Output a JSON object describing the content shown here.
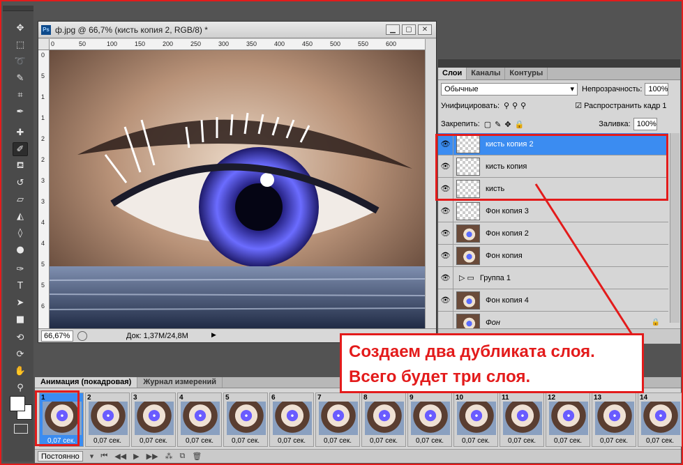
{
  "document": {
    "title": "ф.jpg @ 66,7% (кисть копия 2, RGB/8) *",
    "zoom": "66,67%",
    "doc_info": "Док: 1,37M/24,8M",
    "ruler_h": [
      "0",
      "50",
      "100",
      "150",
      "200",
      "250",
      "300",
      "350",
      "400",
      "450",
      "500",
      "550",
      "600"
    ],
    "ruler_v": [
      "0",
      "5",
      "1",
      "1",
      "2",
      "2",
      "3",
      "3",
      "4",
      "4",
      "5",
      "5",
      "6"
    ]
  },
  "layers_panel": {
    "tabs": [
      "Слои",
      "Каналы",
      "Контуры"
    ],
    "blend_mode": "Обычные",
    "opacity_label": "Непрозрачность:",
    "opacity_value": "100%",
    "unify_label": "Унифицировать:",
    "propagate_label": "Распространить кадр 1",
    "lock_label": "Закрепить:",
    "fill_label": "Заливка:",
    "fill_value": "100%",
    "layers": [
      {
        "name": "кисть копия 2",
        "selected": true,
        "thumb": "transparent"
      },
      {
        "name": "кисть копия",
        "selected": false,
        "thumb": "transparent"
      },
      {
        "name": "кисть",
        "selected": false,
        "thumb": "transparent"
      },
      {
        "name": "Фон копия 3",
        "selected": false,
        "thumb": "transparent"
      },
      {
        "name": "Фон копия 2",
        "selected": false,
        "thumb": "image"
      },
      {
        "name": "Фон копия",
        "selected": false,
        "thumb": "image"
      },
      {
        "name": "Группа 1",
        "selected": false,
        "thumb": "folder"
      },
      {
        "name": "Фон копия 4",
        "selected": false,
        "thumb": "image"
      },
      {
        "name": "Фон",
        "selected": false,
        "thumb": "image"
      }
    ]
  },
  "callout": {
    "line1": "Создаем два дубликата слоя.",
    "line2": "Всего будет три слоя."
  },
  "animation_panel": {
    "tabs": [
      "Анимация (покадровая)",
      "Журнал измерений"
    ],
    "frames": [
      {
        "num": "1",
        "delay": "0,07 сек."
      },
      {
        "num": "2",
        "delay": "0,07 сек."
      },
      {
        "num": "3",
        "delay": "0,07 сек."
      },
      {
        "num": "4",
        "delay": "0,07 сек."
      },
      {
        "num": "5",
        "delay": "0,07 сек."
      },
      {
        "num": "6",
        "delay": "0,07 сек."
      },
      {
        "num": "7",
        "delay": "0,07 сек."
      },
      {
        "num": "8",
        "delay": "0,07 сек."
      },
      {
        "num": "9",
        "delay": "0,07 сек."
      },
      {
        "num": "10",
        "delay": "0,07 сек."
      },
      {
        "num": "11",
        "delay": "0,07 сек."
      },
      {
        "num": "12",
        "delay": "0,07 сек."
      },
      {
        "num": "13",
        "delay": "0,07 сек."
      },
      {
        "num": "14",
        "delay": "0,07 сек."
      }
    ],
    "loop": "Постоянно"
  },
  "colors": {
    "accent": "#e31b1b",
    "selection": "#3b8cf1"
  }
}
